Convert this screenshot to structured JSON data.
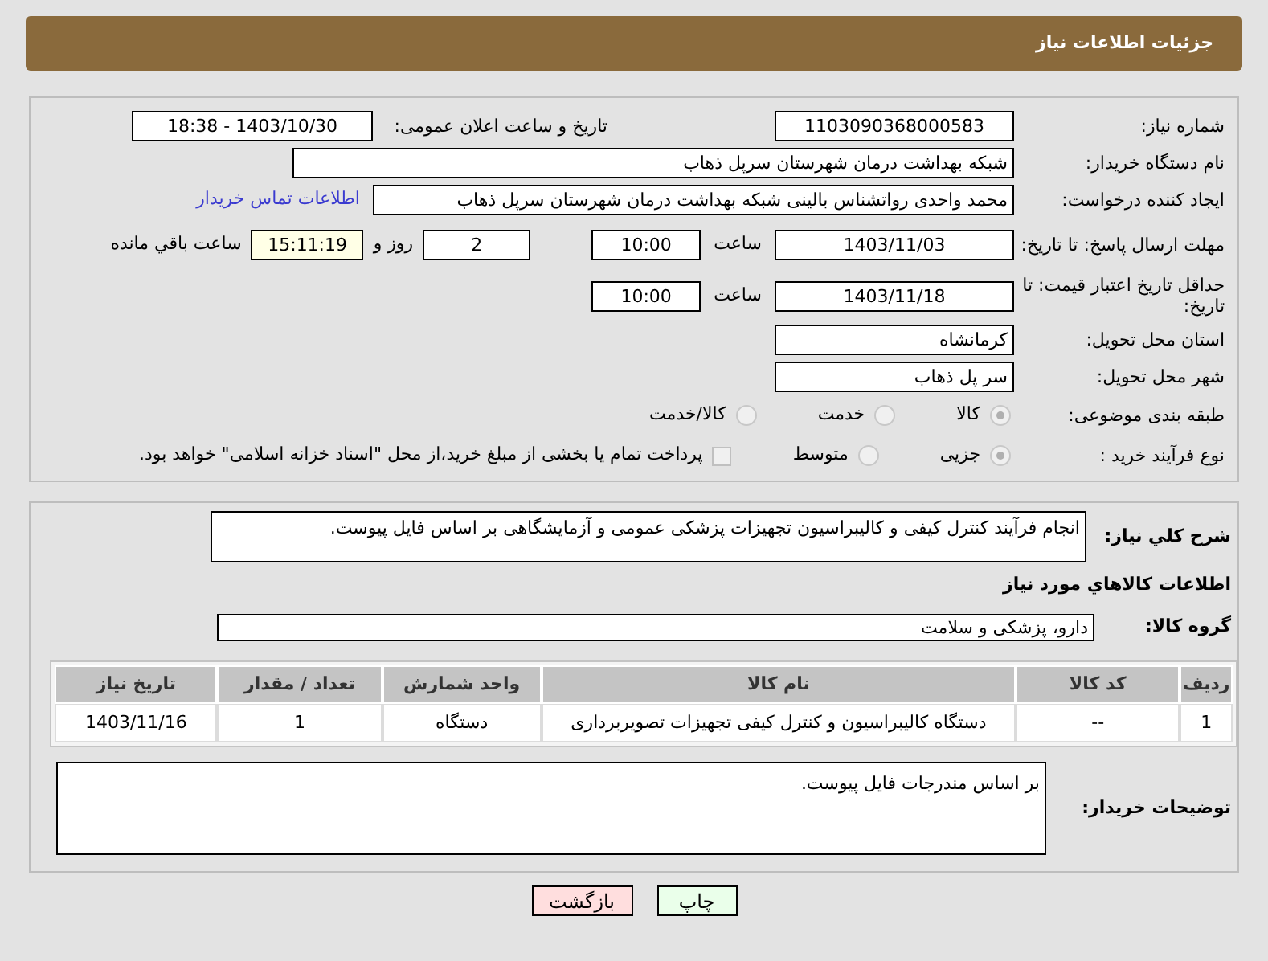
{
  "header": {
    "title": "جزئیات اطلاعات نیاز"
  },
  "need_number": {
    "label": "شماره نیاز:",
    "value": "1103090368000583"
  },
  "announce": {
    "label": "تاریخ و ساعت اعلان عمومی:",
    "value": "1403/10/30 - 18:38"
  },
  "buyer": {
    "label": "نام دستگاه خریدار:",
    "value": "شبکه بهداشت درمان شهرستان سرپل ذهاب"
  },
  "creator": {
    "label": "ایجاد کننده درخواست:",
    "value": "محمد واحدی رواتشناس بالینی شبکه بهداشت درمان شهرستان سرپل ذهاب",
    "link": "اطلاعات تماس خریدار"
  },
  "reply_deadline": {
    "label": "مهلت ارسال پاسخ: تا تاریخ:",
    "date": "1403/11/03",
    "time_label": "ساعت",
    "time": "10:00",
    "days": "2",
    "days_label": "روز و",
    "remaining": "15:11:19",
    "remaining_label": "ساعت باقي مانده"
  },
  "price_validity": {
    "label": "حداقل تاریخ اعتبار قیمت: تا تاریخ:",
    "date": "1403/11/18",
    "time_label": "ساعت",
    "time": "10:00"
  },
  "province": {
    "label": "استان محل تحویل:",
    "value": "کرمانشاه"
  },
  "city": {
    "label": "شهر محل تحویل:",
    "value": "سر پل ذهاب"
  },
  "category": {
    "label": "طبقه بندی موضوعی:",
    "disabled": true,
    "options": [
      {
        "label": "کالا",
        "selected": true
      },
      {
        "label": "خدمت",
        "selected": false
      },
      {
        "label": "کالا/خدمت",
        "selected": false
      }
    ]
  },
  "purchase_type": {
    "label": "نوع فرآیند خرید :",
    "disabled": true,
    "options": [
      {
        "label": "جزیی",
        "selected": true
      },
      {
        "label": "متوسط",
        "selected": false
      }
    ],
    "treasury": {
      "checked": false,
      "label": "پرداخت تمام یا بخشی از مبلغ خرید،از محل \"اسناد خزانه اسلامی\" خواهد بود."
    }
  },
  "description": {
    "label": "شرح کلي نیاز:",
    "value": "انجام فرآیند کنترل کیفی و کالیبراسیون تجهیزات پزشکی عمومی و آزمایشگاهی بر اساس فایل پیوست."
  },
  "goods_heading": "اطلاعات کالاهاي مورد نیاز",
  "goods_group": {
    "label": "گروه کالا:",
    "value": "دارو، پزشکی و سلامت"
  },
  "table": {
    "columns": [
      "ردیف",
      "کد کالا",
      "نام کالا",
      "واحد شمارش",
      "تعداد / مقدار",
      "تاریخ نیاز"
    ],
    "rows": [
      [
        "1",
        "--",
        "دستگاه کالیبراسیون و کنترل کیفی تجهیزات تصویربرداری",
        "دستگاه",
        "1",
        "1403/11/16"
      ]
    ]
  },
  "buyer_notes": {
    "label": "توضیحات خریدار:",
    "value": "بر اساس مندرجات فایل پیوست."
  },
  "buttons": [
    {
      "label": "چاپ",
      "kind": "print"
    },
    {
      "label": "بازگشت",
      "kind": "back"
    }
  ]
}
